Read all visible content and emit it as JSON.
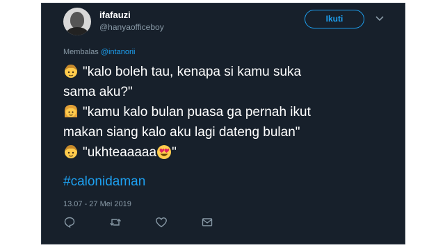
{
  "user": {
    "display_name": "ifafauzi",
    "handle": "@hanyaofficeboy"
  },
  "follow_button": {
    "label": "Ikuti"
  },
  "reply": {
    "prefix": "Membalas",
    "mention": "@intanorii"
  },
  "tweet": {
    "line1": "\"kalo boleh tau, kenapa si kamu suka",
    "line2": "sama aku?\"",
    "line3": "\"kamu kalo bulan puasa ga pernah ikut",
    "line4": "makan siang kalo aku lagi dateng bulan\"",
    "line5_before": "\"ukhteaaaaa",
    "line5_after": "\"",
    "hashtag": "#calonidaman"
  },
  "timestamp": "13.07 - 27 Mei 2019",
  "icons": {
    "boy": "boy-emoji-icon",
    "girl": "girl-emoji-icon",
    "heart_eyes": "heart-eyes-emoji-icon",
    "reply": "reply-icon",
    "retweet": "retweet-icon",
    "like": "heart-icon",
    "message": "envelope-icon",
    "caret": "chevron-down-icon"
  },
  "colors": {
    "background": "#17202b",
    "accent": "#1da1f2",
    "secondary_text": "#8899a6"
  }
}
